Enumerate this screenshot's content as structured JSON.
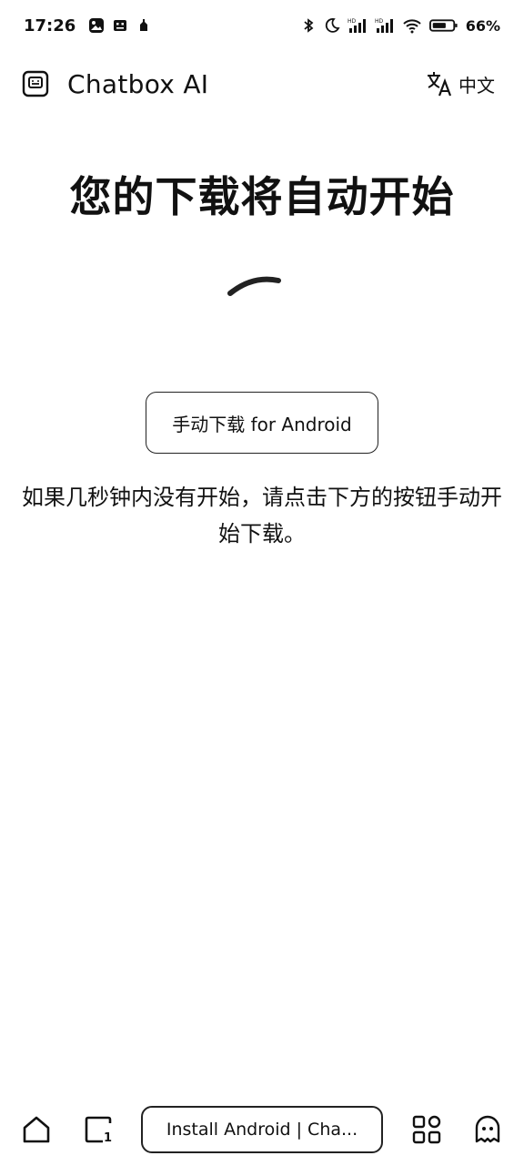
{
  "status_bar": {
    "time": "17:26",
    "battery": "66%",
    "icons": [
      "gallery-icon",
      "robot-icon",
      "notification-icon",
      "bluetooth-icon",
      "do-not-disturb-icon",
      "signal-hd-icon",
      "signal-hd-icon",
      "wifi-icon",
      "battery-icon"
    ]
  },
  "header": {
    "title": "Chatbox AI",
    "logo_icon": "chatbox-logo-icon",
    "language_label": "中文",
    "language_icon": "translate-icon"
  },
  "main": {
    "headline": "您的下载将自动开始",
    "spinner_icon": "loading-spinner-icon",
    "download_button_label": "手动下载 for Android",
    "hint_text": "如果几秒钟内没有开始，请点击下方的按钮手动开始下载。"
  },
  "bottom_bar": {
    "url_label": "Install Android | Cha...",
    "icons": [
      "home-icon",
      "tabs-icon",
      "apps-icon",
      "ghost-icon"
    ]
  }
}
